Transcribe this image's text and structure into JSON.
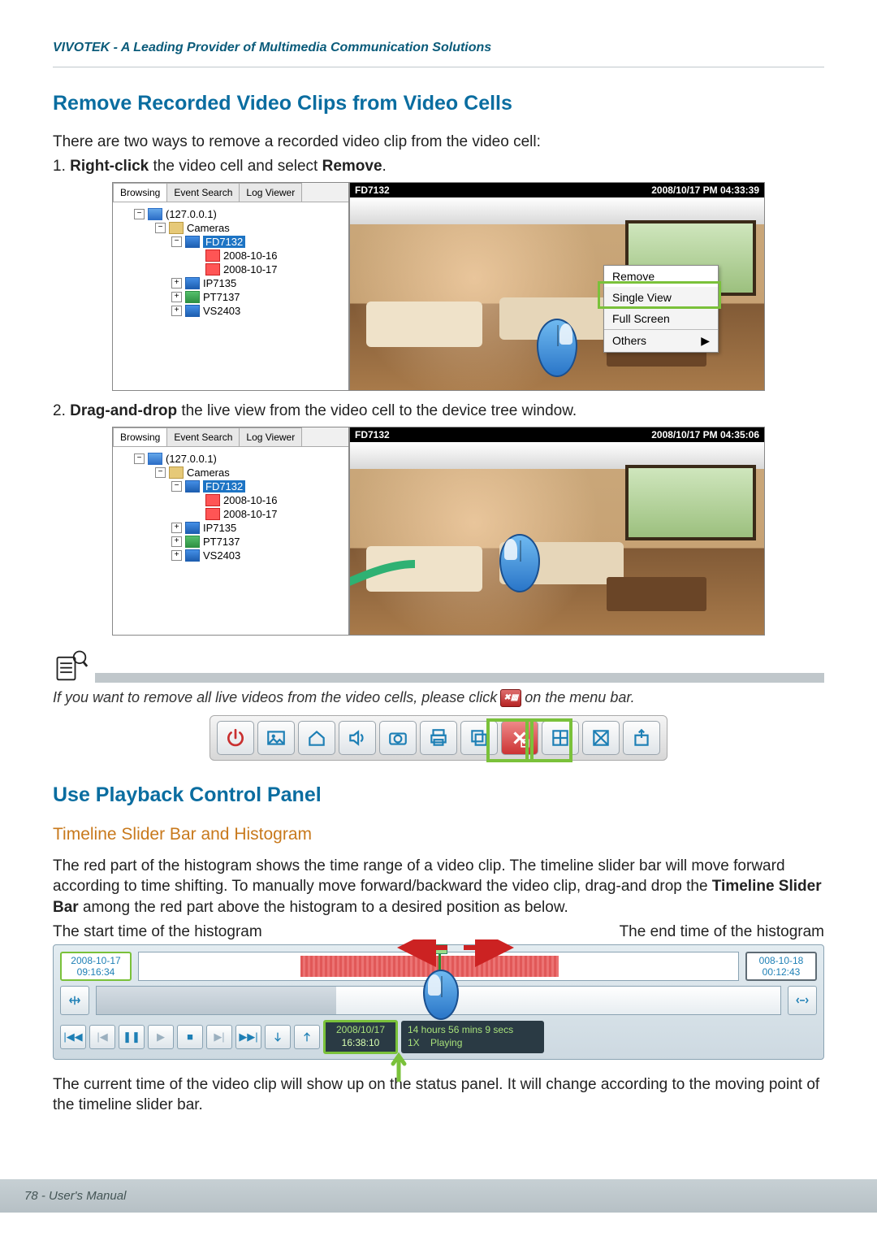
{
  "header": "VIVOTEK - A Leading Provider of Multimedia Communication Solutions",
  "section1": {
    "title": "Remove Recorded Video Clips from Video Cells",
    "intro": "There are two ways to remove a recorded video clip from the video cell:",
    "step1_pre": "1. ",
    "step1_b1": "Right-click",
    "step1_mid": " the video cell and select ",
    "step1_b2": "Remove",
    "step1_post": ".",
    "step2_pre": "2. ",
    "step2_b1": "Drag-and-drop",
    "step2_post": " the live view from the video cell to the device tree window."
  },
  "tree": {
    "tabs": {
      "browsing": "Browsing",
      "event": "Event Search",
      "log": "Log Viewer"
    },
    "host": "(127.0.0.1)",
    "cameras": "Cameras",
    "cam1": "FD7132",
    "date1": "2008-10-16",
    "date2": "2008-10-17",
    "cam2": "IP7135",
    "cam3": "PT7137",
    "cam4": "VS2403"
  },
  "video1": {
    "title": "FD7132",
    "ts": "2008/10/17 PM 04:33:39"
  },
  "video2": {
    "title": "FD7132",
    "ts": "2008/10/17 PM 04:35:06"
  },
  "context": {
    "remove": "Remove",
    "single": "Single View",
    "full": "Full Screen",
    "others": "Others"
  },
  "note": {
    "pre": "If you want to remove all live videos from the video cells, please click",
    "post": "on the menu bar."
  },
  "section2": {
    "title": "Use Playback Control Panel",
    "sub": "Timeline Slider Bar and Histogram",
    "p1a": "The red part of the histogram shows the time range of a video clip. The timeline slider bar will move forward according to time shifting. To manually move forward/backward the video clip, drag-and drop the ",
    "p1b": "Timeline Slider Bar",
    "p1c": " among the red part above the histogram to a desired position as below.",
    "start_label": "The start time of the histogram",
    "end_label": "The end time of the histogram",
    "p2": "The current time of the video clip will show up on the status panel. It will change according to the moving point of the timeline slider bar."
  },
  "timeline": {
    "start_date": "2008-10-17",
    "start_time": "09:16:34",
    "end_date": "008-10-18",
    "end_time": "00:12:43",
    "cur_date": "2008/10/17",
    "cur_time": "16:38:10",
    "duration": "14 hours 56 mins 9 secs",
    "speed": "1X",
    "state": "Playing"
  },
  "footer": "78 - User's Manual"
}
